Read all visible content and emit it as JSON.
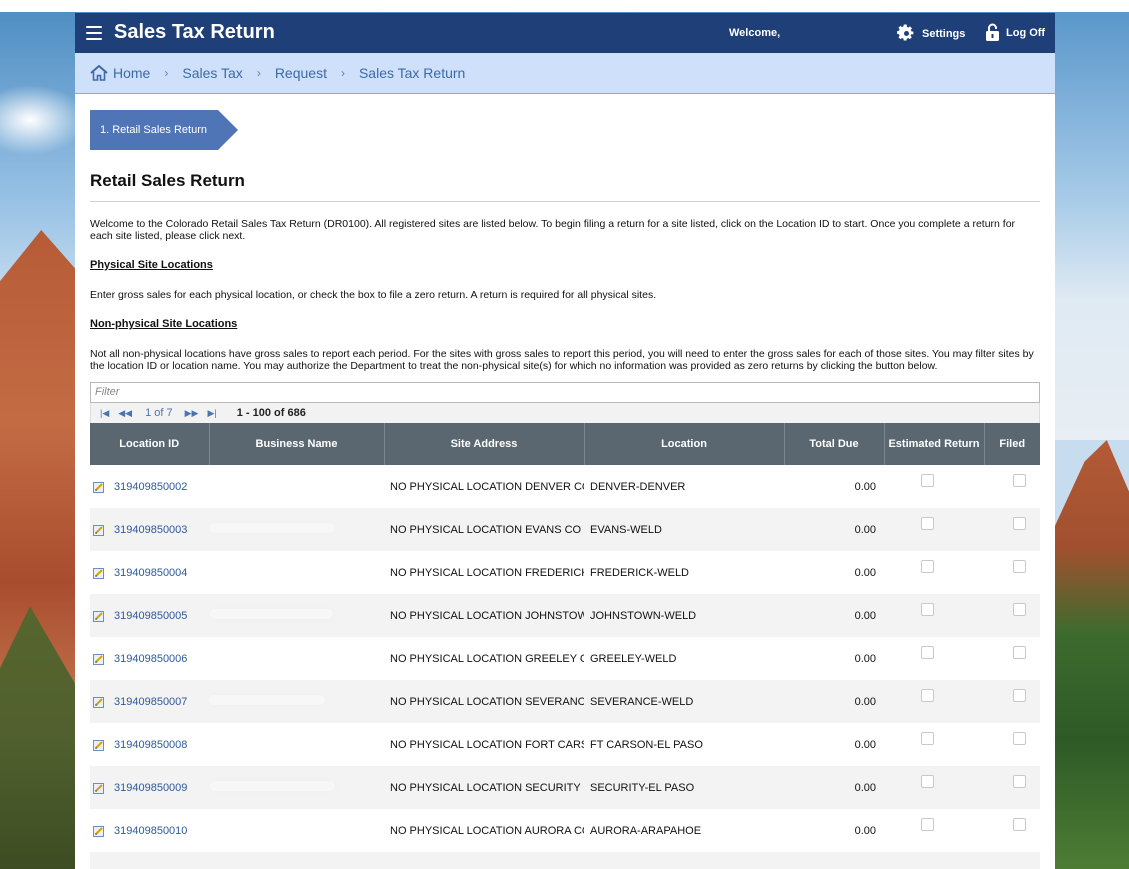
{
  "header": {
    "title": "Sales Tax Return",
    "welcome": "Welcome,",
    "settings_label": "Settings",
    "logoff_label": "Log Off",
    "bar_color": "#1e3f78"
  },
  "breadcrumb": [
    "Home",
    "Sales Tax",
    "Request",
    "Sales Tax Return"
  ],
  "wizard": {
    "step_label": "1. Retail Sales Return"
  },
  "page": {
    "title": "Retail Sales Return",
    "intro": "Welcome to the Colorado Retail Sales Tax Return (DR0100). All registered sites are listed below. To begin filing a return for a site listed, click on the Location ID to start. Once you complete a return for each site listed, please click next.",
    "physical_title": "Physical Site Locations",
    "physical_text": "Enter gross sales for each physical location, or check the box to file a zero return. A return is required for all physical sites.",
    "nonphysical_title": "Non-physical Site Locations",
    "nonphysical_text": "Not all non-physical locations have gross sales to report each period. For the sites with gross sales to report this period, you will need to enter the gross sales for each of those sites. You may filter sites by the location ID or location name. You may authorize the Department to treat the non-physical site(s) for which no information was provided as zero returns by clicking the button below."
  },
  "filter": {
    "placeholder": "Filter"
  },
  "pager": {
    "page_text": "1 of 7",
    "range_text": "1 - 100 of 686"
  },
  "table": {
    "columns": [
      "Location ID",
      "Business Name",
      "Site Address",
      "Location",
      "Total Due",
      "Estimated Return",
      "Filed"
    ],
    "rows": [
      {
        "id": "319409850002",
        "address": "NO PHYSICAL LOCATION DENVER CO",
        "location": "DENVER-DENVER",
        "total": "0.00"
      },
      {
        "id": "319409850003",
        "address": "NO PHYSICAL LOCATION EVANS CO",
        "location": "EVANS-WELD",
        "total": "0.00"
      },
      {
        "id": "319409850004",
        "address": "NO PHYSICAL LOCATION FREDERICK",
        "location": "FREDERICK-WELD",
        "total": "0.00"
      },
      {
        "id": "319409850005",
        "address": "NO PHYSICAL LOCATION JOHNSTOWN",
        "location": "JOHNSTOWN-WELD",
        "total": "0.00"
      },
      {
        "id": "319409850006",
        "address": "NO PHYSICAL LOCATION GREELEY CO",
        "location": "GREELEY-WELD",
        "total": "0.00"
      },
      {
        "id": "319409850007",
        "address": "NO PHYSICAL LOCATION SEVERANCE",
        "location": "SEVERANCE-WELD",
        "total": "0.00"
      },
      {
        "id": "319409850008",
        "address": "NO PHYSICAL LOCATION FORT CARSON",
        "location": "FT CARSON-EL PASO",
        "total": "0.00"
      },
      {
        "id": "319409850009",
        "address": "NO PHYSICAL LOCATION SECURITY",
        "location": "SECURITY-EL PASO",
        "total": "0.00"
      },
      {
        "id": "319409850010",
        "address": "NO PHYSICAL LOCATION AURORA CO",
        "location": "AURORA-ARAPAHOE",
        "total": "0.00"
      }
    ]
  }
}
